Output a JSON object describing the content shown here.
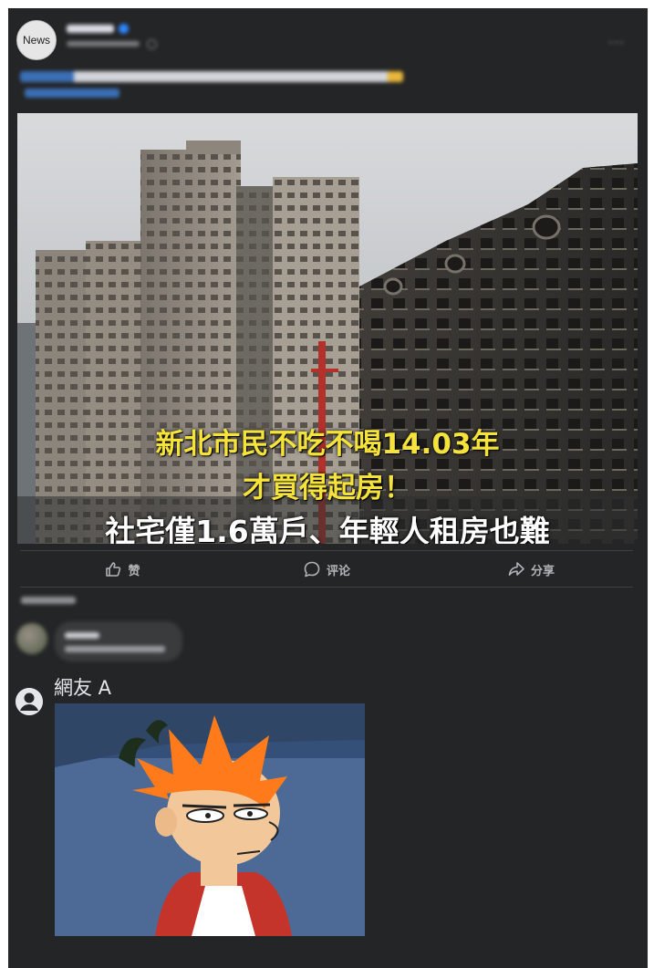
{
  "post": {
    "avatar_text": "News",
    "more_label": "···",
    "image_caption": {
      "line1": "新北市民不吃不喝14.03年",
      "line2": "才買得起房！",
      "line3": "社宅僅1.6萬戶、年輕人租房也難"
    },
    "actions": {
      "like_label": "赞",
      "comment_label": "评论",
      "share_label": "分享"
    }
  },
  "reply": {
    "author": "網友 A"
  },
  "colors": {
    "card_bg": "#242526",
    "caption_yellow": "#f5e33b",
    "action_text": "#b0b3b8"
  }
}
